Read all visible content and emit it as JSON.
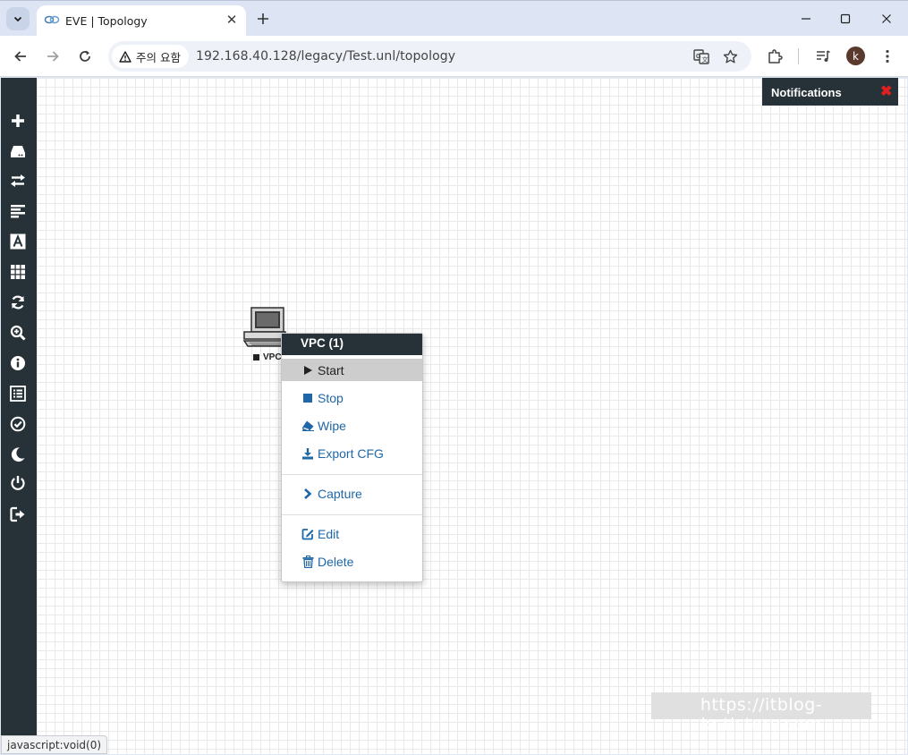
{
  "browser": {
    "tab_title": "EVE | Topology",
    "security_label": "주의 요함",
    "url": "192.168.40.128/legacy/Test.unl/topology",
    "avatar_letter": "k"
  },
  "sidebar": {
    "items": [
      {
        "icon": "plus-icon"
      },
      {
        "icon": "hdd-icon"
      },
      {
        "icon": "exchange-icon"
      },
      {
        "icon": "align-left-icon"
      },
      {
        "icon": "font-icon"
      },
      {
        "icon": "grid-icon"
      },
      {
        "icon": "refresh-icon"
      },
      {
        "icon": "zoom-in-icon"
      },
      {
        "icon": "info-icon"
      },
      {
        "icon": "list-icon"
      },
      {
        "icon": "check-circle-icon"
      },
      {
        "icon": "moon-icon"
      },
      {
        "icon": "power-icon"
      },
      {
        "icon": "logout-icon"
      }
    ]
  },
  "notifications": {
    "title": "Notifications",
    "close": "✖"
  },
  "node": {
    "label": "VPC",
    "icon": "computer-icon"
  },
  "context_menu": {
    "title": "VPC (1)",
    "items": [
      {
        "label": "Start",
        "icon": "play-icon"
      },
      {
        "label": "Stop",
        "icon": "stop-icon"
      },
      {
        "label": "Wipe",
        "icon": "eraser-icon"
      },
      {
        "label": "Export CFG",
        "icon": "download-icon"
      },
      {
        "label": "Capture",
        "icon": "chevron-right-icon"
      },
      {
        "label": "Edit",
        "icon": "edit-icon"
      },
      {
        "label": "Delete",
        "icon": "trash-icon"
      }
    ]
  },
  "watermark": "https://itblog-kr.tistory.com",
  "status_bar": "javascript:void(0)",
  "colors": {
    "sidebar_bg": "#263238",
    "link_blue": "#1f67a6",
    "notif_close": "#e02020",
    "hover_gray": "#cdcdcd"
  }
}
